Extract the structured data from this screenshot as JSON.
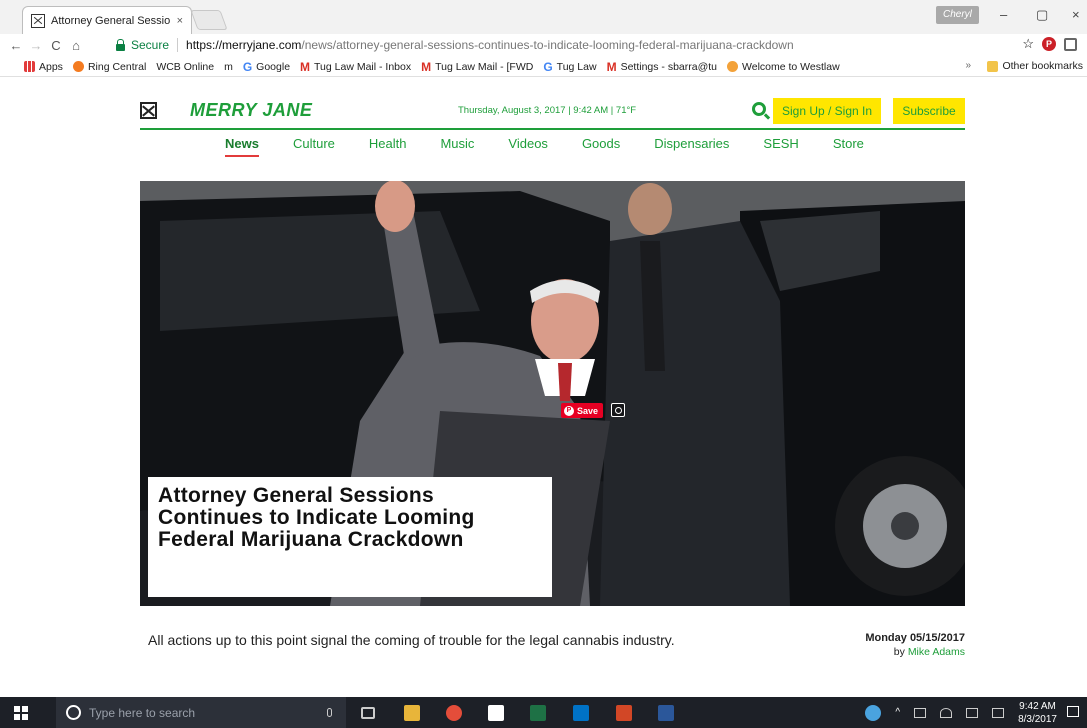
{
  "browser": {
    "tab_title": "Attorney General Sessio",
    "tab_close": "×",
    "profile": "Cheryl",
    "secure_label": "Secure",
    "url_host": "https://merryjane.com",
    "url_path": "/news/attorney-general-sessions-continues-to-indicate-looming-federal-marijuana-crackdown",
    "window_minimize": "–",
    "window_restore": "▢",
    "window_close": "×",
    "star": "☆",
    "bookmarks": [
      {
        "label": "Apps",
        "icon": "apps-icon"
      },
      {
        "label": "Ring Central",
        "icon": "ring-central-icon"
      },
      {
        "label": "WCB Online",
        "icon": "page-icon"
      },
      {
        "label": "m",
        "icon": "page-icon"
      },
      {
        "label": "Google",
        "icon": "google-icon"
      },
      {
        "label": "Tug Law Mail - Inbox",
        "icon": "gmail-icon"
      },
      {
        "label": "Tug Law Mail - [FWD",
        "icon": "gmail-icon"
      },
      {
        "label": "Tug Law",
        "icon": "google-icon"
      },
      {
        "label": "Settings - sbarra@tu",
        "icon": "gmail-icon"
      },
      {
        "label": "Welcome to Westlaw",
        "icon": "westlaw-icon"
      }
    ],
    "bookmarks_more": "»",
    "other_bookmarks": "Other bookmarks"
  },
  "site": {
    "name": "MERRY JANE",
    "date_line": "Thursday, August 3, 2017 | 9:42 AM | 71°F",
    "sign_in": "Sign Up / Sign In",
    "subscribe": "Subscribe",
    "nav": [
      "News",
      "Culture",
      "Health",
      "Music",
      "Videos",
      "Goods",
      "Dispensaries",
      "SESH",
      "Store"
    ],
    "active_nav": "News",
    "accent_color": "#1e9e3a",
    "button_color": "#ffe600"
  },
  "article": {
    "headline": "Attorney General Sessions Continues to Indicate Looming Federal Marijuana Crackdown",
    "pin_save": "Save",
    "subtitle": "All actions up to this point signal the coming of trouble for the legal cannabis industry.",
    "date": "Monday 05/15/2017",
    "by_label": "by",
    "author": "Mike Adams"
  },
  "taskbar": {
    "search_placeholder": "Type here to search",
    "time": "9:42 AM",
    "date": "8/3/2017"
  }
}
